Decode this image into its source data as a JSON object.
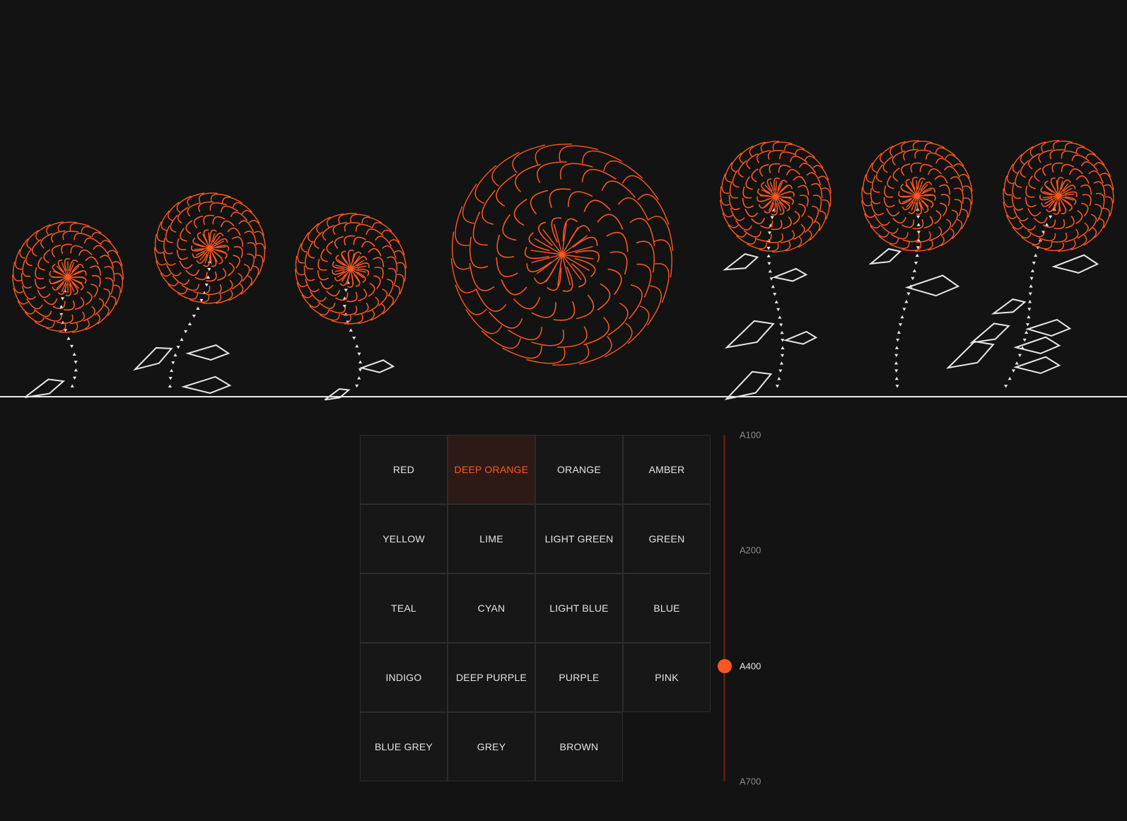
{
  "theme": {
    "accent": "#ff5722",
    "background": "#131313",
    "line": "#e8e8e8"
  },
  "palette": {
    "selected": "DEEP ORANGE",
    "colors": [
      {
        "label": "RED"
      },
      {
        "label": "DEEP ORANGE"
      },
      {
        "label": "ORANGE"
      },
      {
        "label": "AMBER"
      },
      {
        "label": "YELLOW"
      },
      {
        "label": "LIME"
      },
      {
        "label": "LIGHT GREEN"
      },
      {
        "label": "GREEN"
      },
      {
        "label": "TEAL"
      },
      {
        "label": "CYAN"
      },
      {
        "label": "LIGHT BLUE"
      },
      {
        "label": "BLUE"
      },
      {
        "label": "INDIGO"
      },
      {
        "label": "DEEP PURPLE"
      },
      {
        "label": "PURPLE"
      },
      {
        "label": "PINK"
      },
      {
        "label": "BLUE GREY"
      },
      {
        "label": "GREY"
      },
      {
        "label": "BROWN"
      }
    ]
  },
  "shade": {
    "labels": [
      "A100",
      "A200",
      "A400",
      "A700"
    ],
    "selected": "A400",
    "selected_index": 2
  }
}
